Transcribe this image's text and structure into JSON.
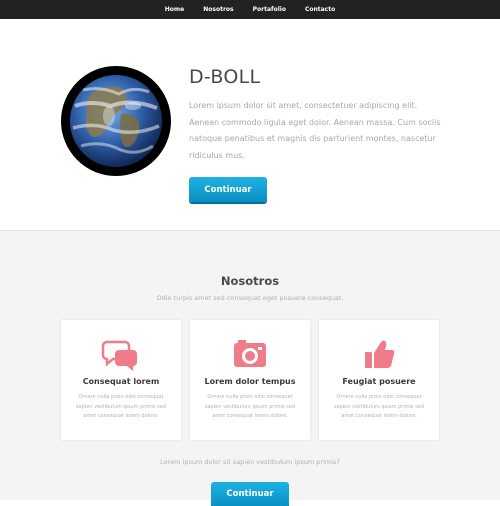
{
  "nav": {
    "items": [
      "Home",
      "Nosotros",
      "Portafolio",
      "Contacto"
    ]
  },
  "hero": {
    "title": "D-BOLL",
    "text": "Lorem ipsum dolor sit amet, consectetuer adipiscing elit. Aenean commodo ligula eget dolor. Aenean massa. Cum sociis natoque penatibus et magnis dis parturient montes, nascetur ridiculus mus.",
    "button_label": "Continuar",
    "image": "earth-globe"
  },
  "about": {
    "title": "Nosotros",
    "subtitle": "Odio turpis amet sed consequat eget posuere consequat.",
    "cards": [
      {
        "icon": "chat-bubbles-icon",
        "title": "Consequat lorem",
        "text": "Ornare nulla proin odio consequat sapien vestibulum ipsum primis sed amet consequat lorem dolore."
      },
      {
        "icon": "camera-icon",
        "title": "Lorem dolor tempus",
        "text": "Ornare nulla proin odio consequat sapien vestibulum ipsum primis sed amet consequat lorem dolore."
      },
      {
        "icon": "thumbs-up-icon",
        "title": "Feugiat posuere",
        "text": "Ornare nulla proin odio consequat sapien vestibulum ipsum primis sed amet consequat lorem dolore."
      }
    ],
    "footer_text": "Lorem ipsum dolor sit sapien vestibulum ipsum primis?",
    "button_label": "Continuar"
  },
  "colors": {
    "nav_bg": "#222222",
    "accent": "#1aa9dc",
    "icon": "#f07c8a",
    "section_bg": "#f4f4f4"
  }
}
